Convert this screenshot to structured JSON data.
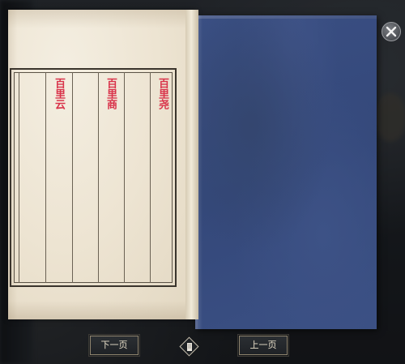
{
  "book": {
    "names": [
      "百里尧",
      "百里商",
      "百里云"
    ]
  },
  "nav": {
    "next_label": "下一页",
    "prev_label": "上一页"
  },
  "icons": {
    "close": "close-x-icon",
    "center": "book-page-icon"
  },
  "colors": {
    "name_text": "#d9334a",
    "cover": "#3a4f83",
    "paper": "#efe7d6"
  }
}
